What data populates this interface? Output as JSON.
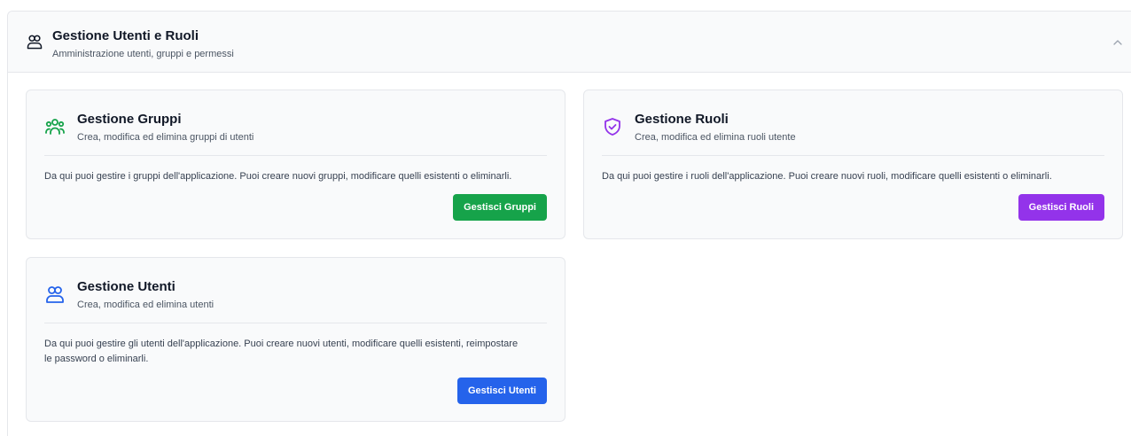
{
  "section": {
    "title": "Gestione Utenti e Ruoli",
    "subtitle": "Amministrazione utenti, gruppi e permessi",
    "icon": "users-icon"
  },
  "cards": {
    "groups": {
      "title": "Gestione Gruppi",
      "subtitle": "Crea, modifica ed elimina gruppi di utenti",
      "description": "Da qui puoi gestire i gruppi dell'applicazione. Puoi creare nuovi gruppi, modificare quelli esistenti o eliminarli.",
      "button_label": "Gestisci Gruppi",
      "icon": "user-group-icon",
      "accent": "#16a34a"
    },
    "roles": {
      "title": "Gestione Ruoli",
      "subtitle": "Crea, modifica ed elimina ruoli utente",
      "description": "Da qui puoi gestire i ruoli dell'applicazione. Puoi creare nuovi ruoli, modificare quelli esistenti o eliminarli.",
      "button_label": "Gestisci Ruoli",
      "icon": "shield-check-icon",
      "accent": "#9333ea"
    },
    "users": {
      "title": "Gestione Utenti",
      "subtitle": "Crea, modifica ed elimina utenti",
      "description": "Da qui puoi gestire gli utenti dell'applicazione. Puoi creare nuovi utenti, modificare quelli esistenti, reimpostare le password o eliminarli.",
      "button_label": "Gestisci Utenti",
      "icon": "users-icon",
      "accent": "#2563eb"
    }
  }
}
